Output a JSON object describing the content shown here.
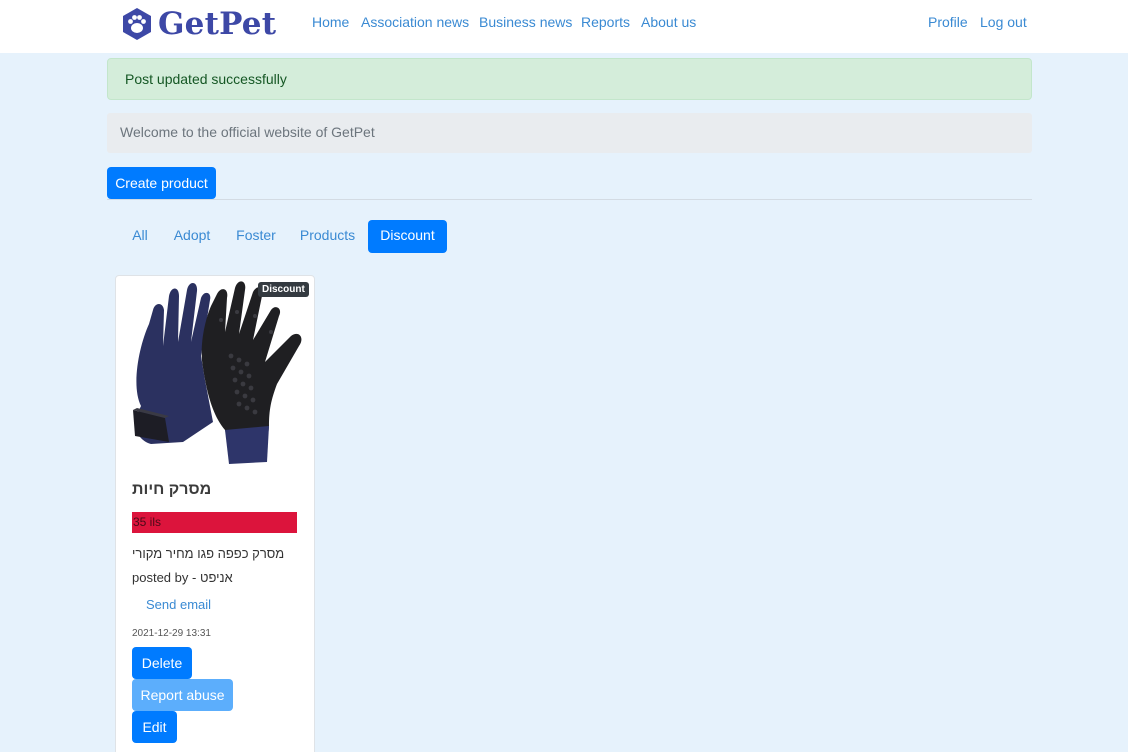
{
  "brand": {
    "name": "GetPet",
    "logo_icon": "paw-icon",
    "color": "#3d48a6"
  },
  "nav": {
    "left": [
      "Home",
      "Association news",
      "Business news",
      "Reports",
      "About us"
    ],
    "right": [
      "Profile",
      "Log out"
    ]
  },
  "alert": {
    "text": "Post updated successfully",
    "type": "success"
  },
  "welcome": {
    "text": "Welcome to the official website of GetPet"
  },
  "create_button": "Create product",
  "filters": {
    "items": [
      "All",
      "Adopt",
      "Foster",
      "Products",
      "Discount"
    ],
    "selected": "Discount"
  },
  "card": {
    "image_icon": "pet-grooming-glove-image",
    "badge": "Discount",
    "title": "מסרק חיות",
    "price": "35 ils",
    "price_color": "#dc143c",
    "description": "מסרק כפפה פגו מחיר מקורי",
    "posted_by_label": "posted by -",
    "posted_by_name": "אניפט",
    "send_email": "Send email",
    "timestamp": "2021-12-29 13:31",
    "buttons": {
      "delete": "Delete",
      "report": "Report abuse",
      "edit": "Edit"
    }
  },
  "colors": {
    "accent": "#007bff",
    "link": "#3a8ad3",
    "background": "#e6f2fc"
  }
}
